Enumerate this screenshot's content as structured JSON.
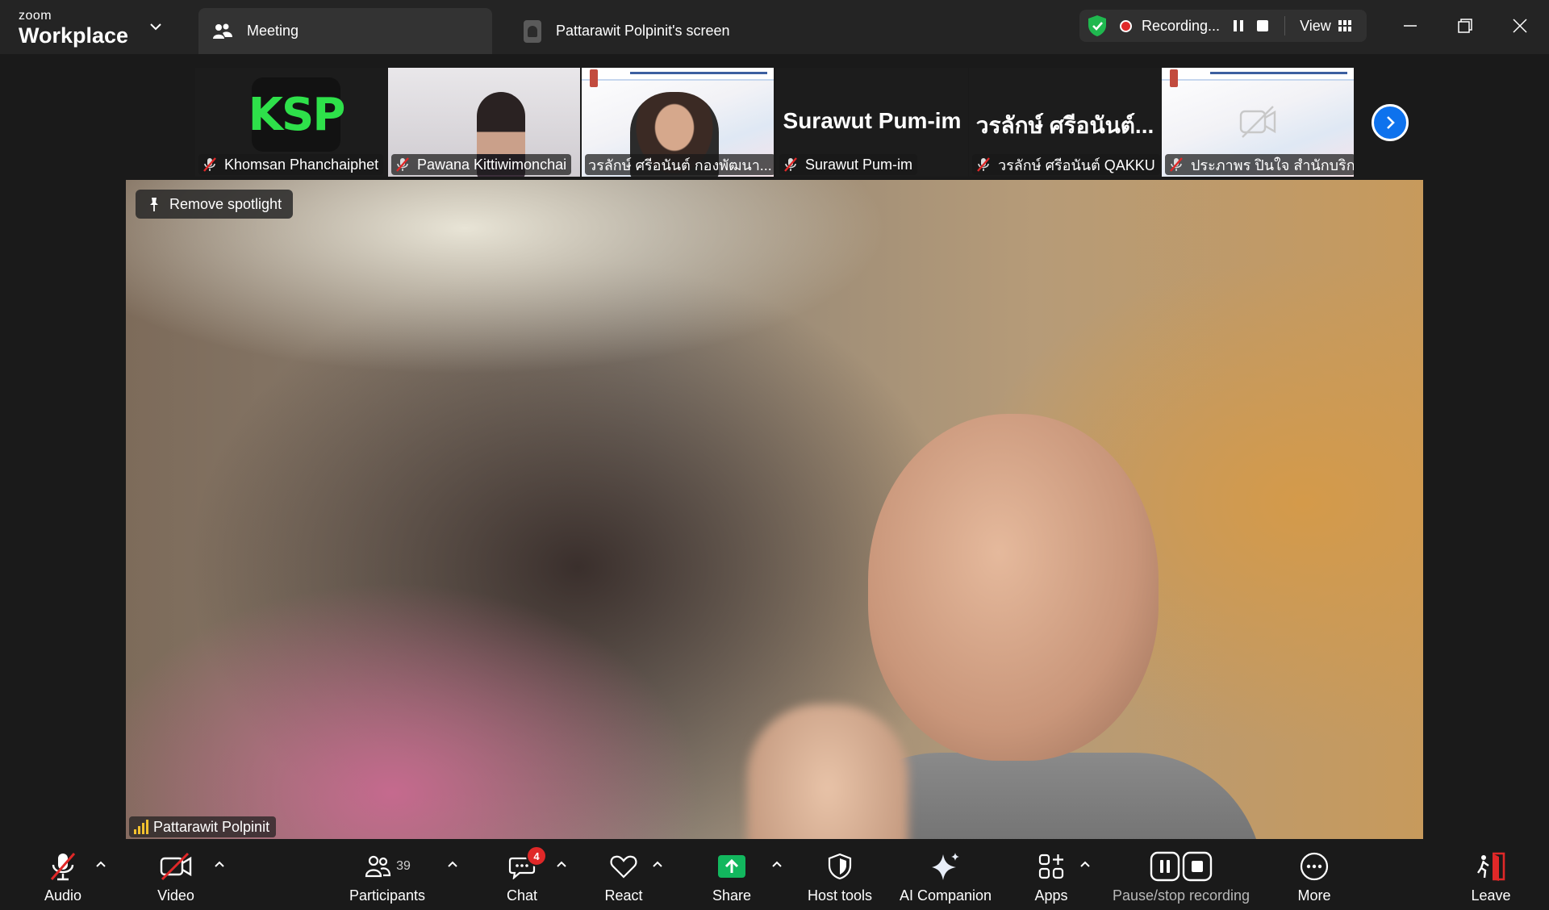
{
  "titlebar": {
    "brand_small": "zoom",
    "brand_big": "Workplace",
    "tab_meeting": "Meeting",
    "tab_screen": "Pattarawit Polpinit's screen",
    "recording_status": "Recording...",
    "view_label": "View"
  },
  "thumbnails": [
    {
      "name": "Khomsan Phanchaiphet"
    },
    {
      "name": "Pawana Kittiwimonchai"
    },
    {
      "name": "วรลักษ์ ศรีอนันต์ กองพัฒนา..."
    },
    {
      "name": "Surawut Pum-im",
      "big_name": "Surawut Pum-im"
    },
    {
      "name": "วรลักษ์ ศรีอนันต์ QAKKU",
      "big_name": "วรลักษ์ ศรีอนันต์..."
    },
    {
      "name": "ประภาพร ปินใจ สำนักบริก..."
    }
  ],
  "thumb_logo_text": "KSP",
  "main": {
    "spotlight_button": "Remove spotlight",
    "speaker_name": "Pattarawit Polpinit"
  },
  "toolbar": {
    "audio": "Audio",
    "video": "Video",
    "participants": "Participants",
    "participants_count": "39",
    "chat": "Chat",
    "chat_badge": "4",
    "react": "React",
    "share": "Share",
    "host_tools": "Host tools",
    "ai_companion": "AI Companion",
    "apps": "Apps",
    "pause_stop_recording": "Pause/stop recording",
    "more": "More",
    "leave": "Leave"
  },
  "colors": {
    "accent_blue": "#0e72ed",
    "share_green": "#12b75e",
    "mute_red": "#e02828",
    "shield_green": "#1fb84f",
    "leave_red": "#e02828"
  }
}
